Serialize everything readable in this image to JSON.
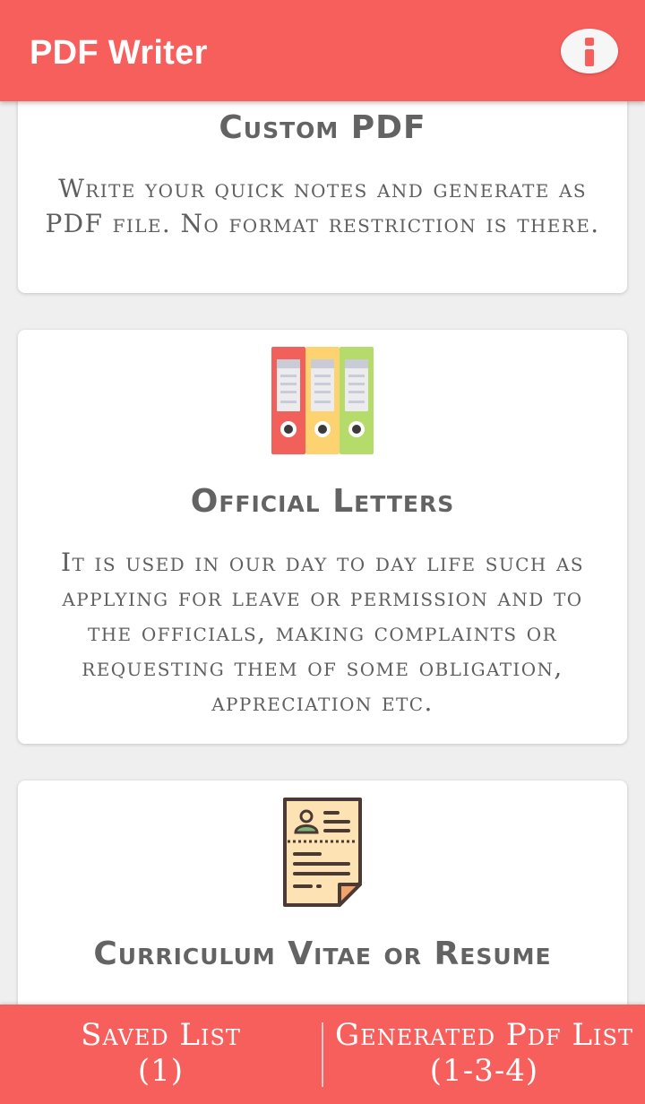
{
  "app_bar": {
    "title": "PDF Writer",
    "info_icon": "info-icon",
    "color": "#f75f5c"
  },
  "cards": [
    {
      "icon": "tablet-icon",
      "title": "Custom PDF",
      "description": "Write your quick notes and generate as PDF file. No format restriction is there."
    },
    {
      "icon": "binders-icon",
      "title": "Official Letters",
      "description": "It is used in our day to day life such as applying for leave or permission and to the officials, making complaints or requesting them of some obligation, appreciation etc."
    },
    {
      "icon": "resume-document-icon",
      "title": "Curriculum Vitae or Resume",
      "description": ""
    }
  ],
  "bottom_bar": {
    "saved": {
      "label": "Saved List",
      "count": "(1)"
    },
    "generated": {
      "label": "Generated Pdf List",
      "count": "(1-3-4)"
    }
  }
}
